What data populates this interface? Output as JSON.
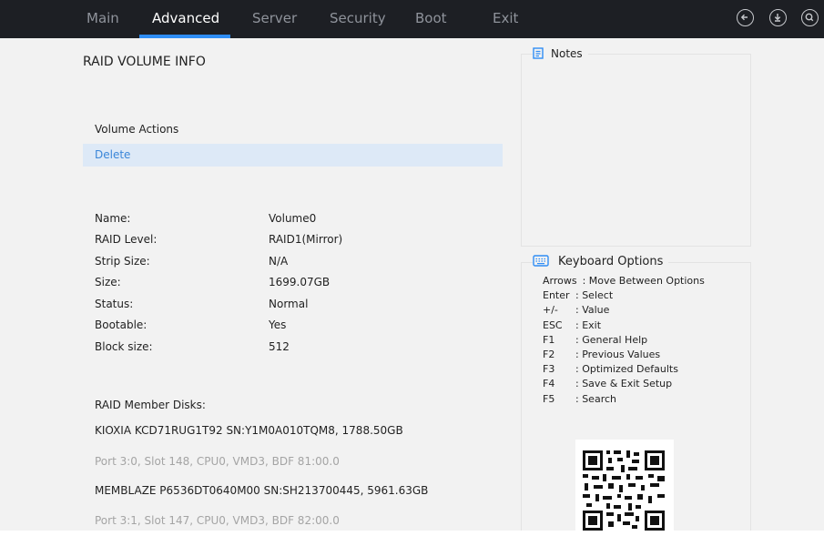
{
  "tabs": [
    {
      "label": "Main"
    },
    {
      "label": "Advanced"
    },
    {
      "label": "Server"
    },
    {
      "label": "Security"
    },
    {
      "label": "Boot"
    },
    {
      "label": "Exit"
    }
  ],
  "icons": [
    "back-icon",
    "download-icon",
    "search-icon"
  ],
  "panel": {
    "title": "RAID VOLUME INFO",
    "volume_actions": "Volume Actions",
    "delete": "Delete",
    "fields": [
      {
        "label": "Name:",
        "value": "Volume0"
      },
      {
        "label": "RAID Level:",
        "value": "RAID1(Mirror)"
      },
      {
        "label": "Strip Size:",
        "value": "N/A"
      },
      {
        "label": "Size:",
        "value": "1699.07GB"
      },
      {
        "label": "Status:",
        "value": "Normal"
      },
      {
        "label": "Bootable:",
        "value": "Yes"
      },
      {
        "label": "Block size:",
        "value": "512"
      }
    ],
    "member_disks_label": "RAID Member Disks:",
    "disks": [
      {
        "name": "KIOXIA KCD71RUG1T92 SN:Y1M0A010TQM8, 1788.50GB",
        "port": "Port  3:0, Slot 148, CPU0, VMD3, BDF 81:00.0"
      },
      {
        "name": "MEMBLAZE P6536DT0640M00 SN:SH213700445, 5961.63GB",
        "port": "Port  3:1, Slot 147, CPU0, VMD3, BDF 82:00.0"
      }
    ]
  },
  "notes": {
    "title": "Notes"
  },
  "keyboard": {
    "title": "Keyboard Options",
    "lines": [
      {
        "key": "Arrows",
        "desc": ": Move Between Options"
      },
      {
        "key": "Enter",
        "desc": ": Select"
      },
      {
        "key": "+/-",
        "desc": ": Value"
      },
      {
        "key": "ESC",
        "desc": ": Exit"
      },
      {
        "key": "F1",
        "desc": ": General Help"
      },
      {
        "key": "F2",
        "desc": ": Previous Values"
      },
      {
        "key": "F3",
        "desc": ": Optimized Defaults"
      },
      {
        "key": "F4",
        "desc": ": Save & Exit Setup"
      },
      {
        "key": "F5",
        "desc": ": Search"
      }
    ]
  },
  "colors": {
    "accent": "#2f8df5",
    "topbar": "#1d1f24",
    "selected_row": "#dde9f7",
    "link": "#3a86d8"
  }
}
